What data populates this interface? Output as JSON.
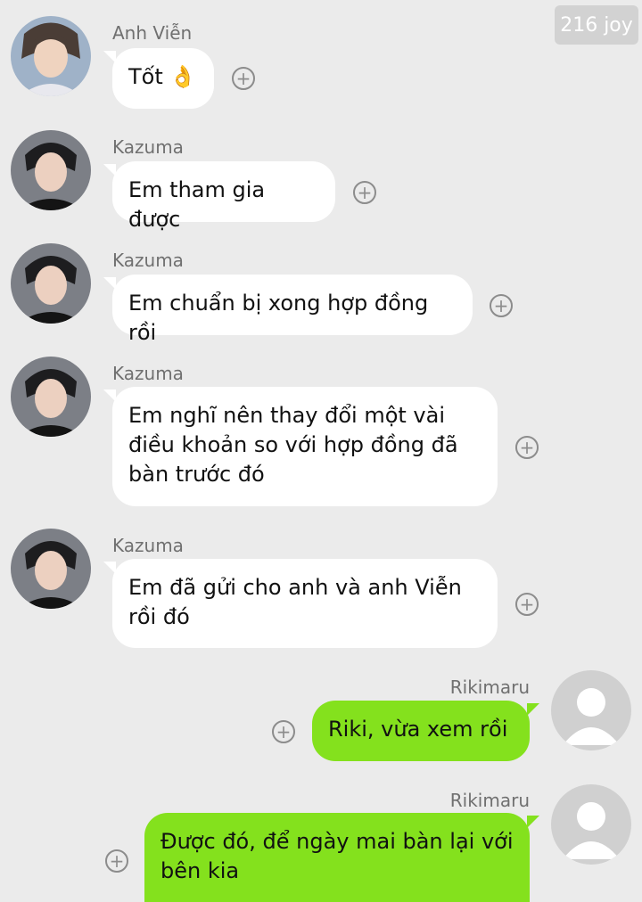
{
  "watermark": "216 joy",
  "messages": [
    {
      "sender": "Anh Viễn",
      "text": "Tốt 👌",
      "direction": "incoming",
      "avatar_icon": "user-photo-avatar-icon"
    },
    {
      "sender": "Kazuma",
      "text": "Em tham gia được",
      "direction": "incoming",
      "avatar_icon": "user-photo-avatar-icon"
    },
    {
      "sender": "Kazuma",
      "text": "Em chuẩn bị xong hợp đồng rồi",
      "direction": "incoming",
      "avatar_icon": "user-photo-avatar-icon"
    },
    {
      "sender": "Kazuma",
      "text": "Em nghĩ nên thay đổi một vài điều khoản so với hợp đồng đã bàn trước đó",
      "direction": "incoming",
      "avatar_icon": "user-photo-avatar-icon"
    },
    {
      "sender": "Kazuma",
      "text": "Em đã gửi cho anh và anh Viễn rồi đó",
      "direction": "incoming",
      "avatar_icon": "user-photo-avatar-icon"
    },
    {
      "sender": "Rikimaru",
      "text": "Riki, vừa xem rồi",
      "direction": "outgoing",
      "avatar_icon": "default-user-avatar-icon"
    },
    {
      "sender": "Rikimaru",
      "text": "Được đó, để ngày mai bàn lại với bên kia",
      "direction": "outgoing",
      "avatar_icon": "default-user-avatar-icon"
    }
  ],
  "add_reaction_icon": "+",
  "colors": {
    "background": "#ebebeb",
    "incoming_bubble": "#ffffff",
    "outgoing_bubble": "#84e11d",
    "name_text": "#707070"
  }
}
